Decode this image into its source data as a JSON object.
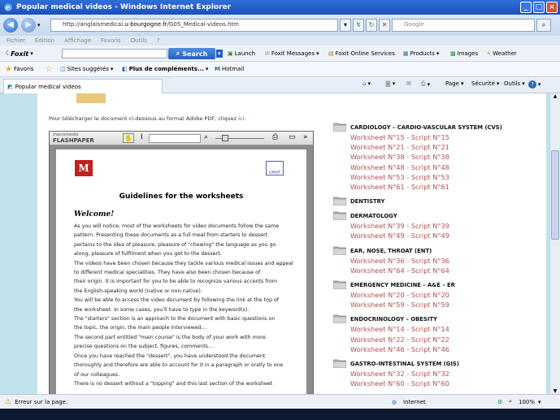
{
  "window": {
    "title": "Popular medical videos - Windows Internet Explorer"
  },
  "address": {
    "prefix": "http://anglaismedical.",
    "domain": "u-bourgogne.fr",
    "path": "/G05_Medical-videos.htm"
  },
  "search": {
    "placeholder": "Google"
  },
  "menubar": [
    "Fichier",
    "Edition",
    "Affichage",
    "Favoris",
    "Outils",
    "?"
  ],
  "foxit": {
    "brand": "Foxit",
    "search_label": "Search",
    "items": [
      "Launch",
      "Foxit Messages",
      "Foxit Online Services",
      "Products",
      "Images",
      "Weather"
    ]
  },
  "favorites": {
    "label": "Favoris",
    "suggested": "Sites suggérés",
    "more": "Plus de compléments...",
    "hotmail": "Hotmail"
  },
  "tab": {
    "title": "Popular medical videos"
  },
  "tools": {
    "page": "Page",
    "security": "Sécurité",
    "outils": "Outils"
  },
  "pdf_text": {
    "before": "Pour télécharger le document ci-dessous au format Adobe PDF, cliquez ",
    "link": "ici",
    "after": "."
  },
  "flashpaper": {
    "brand_top": "macromedia",
    "brand": "FLASHPAPER"
  },
  "doc": {
    "logo_left": "M",
    "logo_right": "UMVF",
    "title": "Guidelines for the worksheets",
    "welcome": "Welcome!",
    "lines": [
      "As you will notice, most of the worksheets for video documents follow the same",
      "pattern. Presenting these documents as a full meal from starters to dessert",
      "pertains to the idea of pleasure, pleasure of \"chewing\" the language as you go",
      "along, pleasure of fulfilment when you get to the dessert.",
      "The videos have been chosen because they tackle various medical issues and appeal",
      "to different medical specialities. They have also been chosen because of",
      "their origin. It is important for you to be able to recognize various accents from",
      "the English-speaking world (native or non-native).",
      "You will be able to access the video document by following the link at the top of",
      "the worksheet. In some cases, you'll have to type in the keyword(s).",
      "The \"starters\" section is an approach to the document with basic questions on",
      "the topic, the origin, the main people interviewed...",
      "The second part entitled \"main course\" is the body of your work with more",
      "precise questions on the subject, figures, comments...",
      "Once you have reached the \"dessert\", you have understood the document",
      "thoroughly and therefore are able to account for it in a paragraph or orally to one",
      "of our colleagues.",
      "There is no dessert without a \"topping\" and this last section of the worksheet"
    ]
  },
  "categories": [
    {
      "title": "CARDIOLOGY – CARDIO-VASCULAR SYSTEM (CVS)",
      "items": [
        "Worksheet N°15 - Script N°15",
        "Worksheet N°21 - Script N°21",
        "Worksheet N°38 - Script N°38",
        "Worksheet N°48 - Script N°48",
        "Worksheet N°53 - Script N°53",
        "Worksheet N°61 - Script N°61"
      ]
    },
    {
      "title": "DENTISTRY",
      "items": []
    },
    {
      "title": "DERMATOLOGY",
      "items": [
        "Worksheet N°39 - Script N°39",
        "Worksheet N°49 - Script N°49"
      ]
    },
    {
      "title": "EAR, NOSE, THROAT (ENT)",
      "items": [
        "Worksheet N°36 - Script N°36",
        "Worksheet N°64 - Script N°64"
      ]
    },
    {
      "title": "EMERGENCY MEDICINE – A&E – ER",
      "items": [
        "Worksheet N°20 - Script N°20",
        "Worksheet N°59 - Script N°59"
      ]
    },
    {
      "title": "ENDOCRINOLOGY – OBESITY",
      "items": [
        "Worksheet N°14 - Script N°14",
        "Worksheet N°22 - Script N°22",
        "Worksheet N°46 - Script N°46"
      ]
    },
    {
      "title": "GASTRO-INTESTINAL SYSTEM (GIS)",
      "items": [
        "Worksheet N°32 - Script N°32",
        "Worksheet N°60 - Script N°60"
      ]
    }
  ],
  "status": {
    "text": "Erreur sur la page.",
    "zone": "Internet",
    "zoom": "100%"
  }
}
